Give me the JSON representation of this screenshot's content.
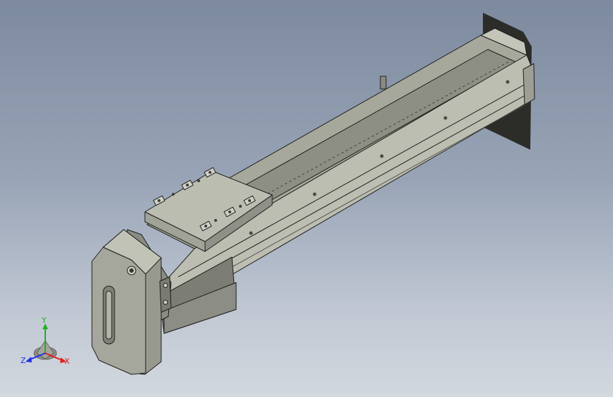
{
  "view": {
    "colors": {
      "background_top": "#7d8a9e",
      "background_bottom": "#d3d8df",
      "model_face_light": "#b9baae",
      "model_face_mid": "#9c9d92",
      "model_face_dark": "#6f7068",
      "model_edge": "#1e1f1c"
    },
    "model": {
      "name": "linear-actuator-module",
      "parts": [
        "motor-housing",
        "rail-body",
        "carriage-plate",
        "end-cap",
        "belt-cover"
      ]
    },
    "triad": {
      "x_label": "X",
      "y_label": "Y",
      "z_label": "Z",
      "x_color": "#e02020",
      "y_color": "#20b020",
      "z_color": "#2030e0"
    }
  }
}
